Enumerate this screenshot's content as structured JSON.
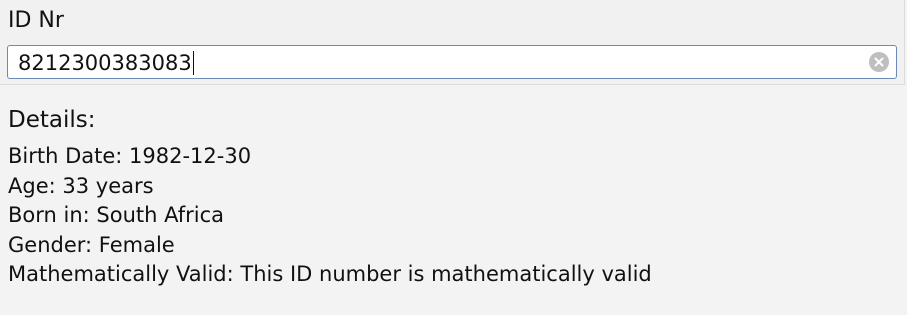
{
  "form": {
    "id_label": "ID Nr",
    "id_value": "8212300383083",
    "clear_icon": "clear-circle-icon"
  },
  "details": {
    "heading": "Details:",
    "lines": [
      "Birth Date: 1982-12-30",
      "Age: 33 years",
      "Born in: South Africa",
      "Gender: Female",
      "Mathematically Valid: This ID number is mathematically valid"
    ]
  },
  "colors": {
    "background": "#f3f3f3",
    "input_border": "#6f89b8",
    "clear_button": "#bfbfbf"
  }
}
